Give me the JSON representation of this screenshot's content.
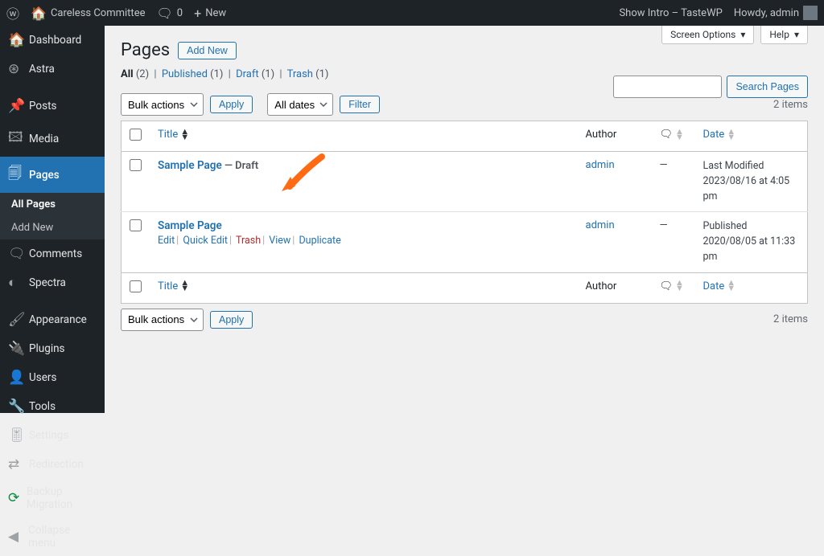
{
  "adminbar": {
    "site_name": "Careless Committee",
    "comments_count": "0",
    "new_label": "New",
    "show_intro": "Show Intro – TasteWP",
    "howdy": "Howdy, admin"
  },
  "sidebar": {
    "dashboard": "Dashboard",
    "astra": "Astra",
    "posts": "Posts",
    "media": "Media",
    "pages": "Pages",
    "all_pages": "All Pages",
    "add_new": "Add New",
    "comments": "Comments",
    "spectra": "Spectra",
    "appearance": "Appearance",
    "plugins": "Plugins",
    "users": "Users",
    "tools": "Tools",
    "settings": "Settings",
    "redirection": "Redirection",
    "backup": "Backup Migration",
    "collapse": "Collapse menu"
  },
  "tabs": {
    "screen_options": "Screen Options",
    "help": "Help"
  },
  "header": {
    "title": "Pages",
    "add_new": "Add New"
  },
  "filters": {
    "all": "All",
    "all_count": "(2)",
    "published": "Published",
    "published_count": "(1)",
    "draft": "Draft",
    "draft_count": "(1)",
    "trash": "Trash",
    "trash_count": "(1)"
  },
  "actions": {
    "bulk": "Bulk actions",
    "apply": "Apply",
    "all_dates": "All dates",
    "filter": "Filter",
    "search": "Search Pages"
  },
  "table": {
    "header": {
      "title": "Title",
      "author": "Author",
      "date": "Date"
    },
    "rows": [
      {
        "title": "Sample Page",
        "state": "— Draft",
        "author": "admin",
        "comments": "—",
        "date_line1": "Last Modified",
        "date_line2": "2023/08/16 at 4:05 pm",
        "show_actions": false
      },
      {
        "title": "Sample Page",
        "state": "",
        "author": "admin",
        "comments": "—",
        "date_line1": "Published",
        "date_line2": "2020/08/05 at 11:33 pm",
        "show_actions": true,
        "actions": {
          "edit": "Edit",
          "quick_edit": "Quick Edit",
          "trash": "Trash",
          "view": "View",
          "duplicate": "Duplicate"
        }
      }
    ],
    "items_count": "2 items"
  }
}
